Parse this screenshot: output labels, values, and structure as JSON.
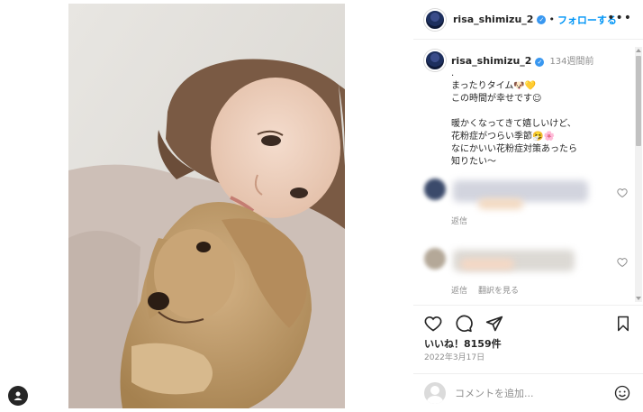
{
  "post": {
    "username": "risa_shimizu_2",
    "verified_mark": "✓",
    "separator": "•",
    "follow_label": "フォローする",
    "more_label": "•••"
  },
  "caption": {
    "username": "risa_shimizu_2",
    "age": "134週間前",
    "text": ".\nまったりタイム🐶💛\nこの時間が幸せです☺︎\n\n暖かくなってきて嬉しいけど、\n花粉症がつらい季節🤧🌸\nなにかいい花粉症対策あったら\n知りたい〜"
  },
  "comments": [
    {
      "reply_label": "返信",
      "translate_label": ""
    },
    {
      "reply_label": "返信",
      "translate_label": "翻訳を見る"
    }
  ],
  "likes": "いいね！8159件",
  "date": "2022年3月17日",
  "comment_input": {
    "placeholder": "コメントを追加..."
  },
  "icons": {
    "heart": "heart-icon",
    "comment": "comment-icon",
    "share": "share-icon",
    "bookmark": "bookmark-icon",
    "emoji": "emoji-icon",
    "more": "more-icon"
  },
  "colors": {
    "accent": "#0095f6",
    "verified": "#3897f0",
    "muted": "#8e8e8e",
    "text": "#262626"
  }
}
